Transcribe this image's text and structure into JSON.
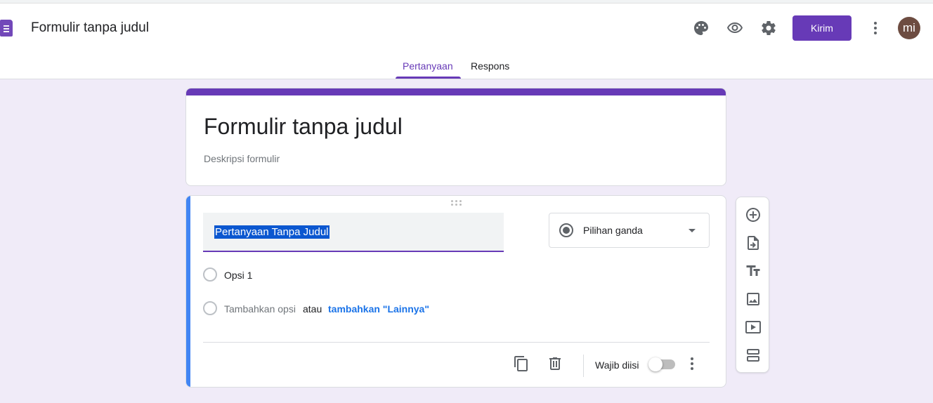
{
  "header": {
    "title": "Formulir tanpa judul",
    "send_label": "Kirim",
    "avatar_initials": "mi",
    "icons": [
      "palette-icon",
      "eye-icon",
      "gear-icon",
      "more-vert-icon"
    ]
  },
  "tabs": [
    {
      "label": "Pertanyaan",
      "active": true
    },
    {
      "label": "Respons",
      "active": false
    }
  ],
  "form": {
    "title": "Formulir tanpa judul",
    "description": "Deskripsi formulir"
  },
  "question": {
    "title": "Pertanyaan Tanpa Judul",
    "type": "Pilihan ganda",
    "options": [
      {
        "label": "Opsi 1"
      }
    ],
    "add_option": "Tambahkan opsi",
    "or_text": "atau",
    "add_other": "tambahkan \"Lainnya\"",
    "required_label": "Wajib diisi",
    "required": false
  },
  "side_toolbar": [
    "add-question-icon",
    "import-questions-icon",
    "add-title-icon",
    "add-image-icon",
    "add-video-icon",
    "add-section-icon"
  ],
  "colors": {
    "accent": "#673ab7",
    "background": "#f0ebf8",
    "focus_border": "#4285f4",
    "link": "#1a73e8"
  }
}
